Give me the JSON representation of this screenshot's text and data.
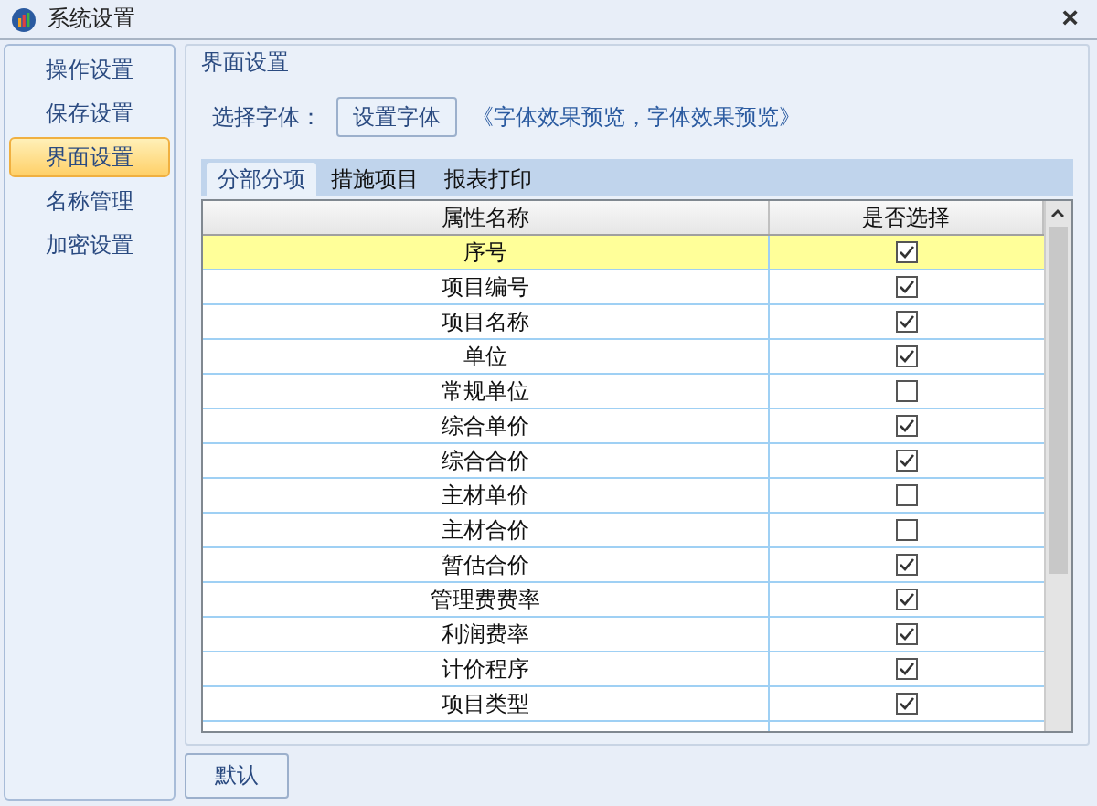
{
  "window": {
    "title": "系统设置",
    "close": "×"
  },
  "sidebar": {
    "items": [
      {
        "label": "操作设置",
        "selected": false
      },
      {
        "label": "保存设置",
        "selected": false
      },
      {
        "label": "界面设置",
        "selected": true
      },
      {
        "label": "名称管理",
        "selected": false
      },
      {
        "label": "加密设置",
        "selected": false
      }
    ]
  },
  "group": {
    "title": "界面设置",
    "font_label": "选择字体：",
    "font_button": "设置字体",
    "preview": "《字体效果预览，字体效果预览》"
  },
  "tabs": [
    {
      "label": "分部分项",
      "selected": true
    },
    {
      "label": "措施项目",
      "selected": false
    },
    {
      "label": "报表打印",
      "selected": false
    }
  ],
  "table": {
    "columns": [
      "属性名称",
      "是否选择"
    ],
    "rows": [
      {
        "name": "序号",
        "checked": true,
        "selected": true
      },
      {
        "name": "项目编号",
        "checked": true,
        "selected": false
      },
      {
        "name": "项目名称",
        "checked": true,
        "selected": false
      },
      {
        "name": "单位",
        "checked": true,
        "selected": false
      },
      {
        "name": "常规单位",
        "checked": false,
        "selected": false
      },
      {
        "name": "综合单价",
        "checked": true,
        "selected": false
      },
      {
        "name": "综合合价",
        "checked": true,
        "selected": false
      },
      {
        "name": "主材单价",
        "checked": false,
        "selected": false
      },
      {
        "name": "主材合价",
        "checked": false,
        "selected": false
      },
      {
        "name": "暂估合价",
        "checked": true,
        "selected": false
      },
      {
        "name": "管理费费率",
        "checked": true,
        "selected": false
      },
      {
        "name": "利润费率",
        "checked": true,
        "selected": false
      },
      {
        "name": "计价程序",
        "checked": true,
        "selected": false
      },
      {
        "name": "项目类型",
        "checked": true,
        "selected": false
      }
    ]
  },
  "buttons": [
    "默认"
  ]
}
